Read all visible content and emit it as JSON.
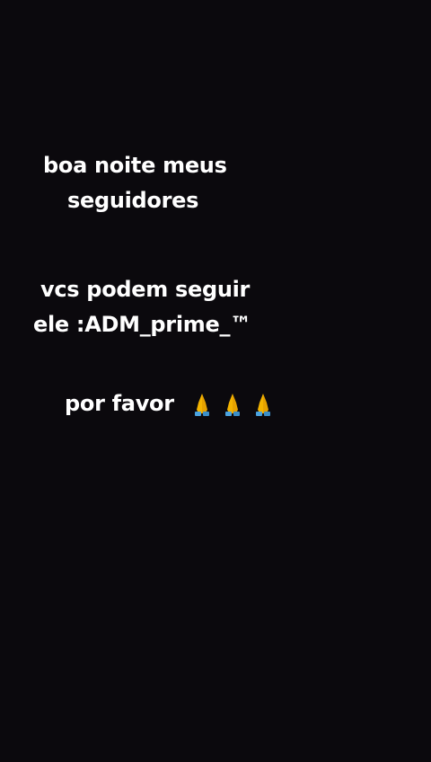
{
  "message": {
    "line1": "boa noite meus",
    "line2": "seguidores",
    "line3": "vcs podem seguir",
    "line4": "ele :ADM_prime_™",
    "line5": "por favor",
    "emojis": [
      "folded-hands",
      "folded-hands",
      "folded-hands"
    ]
  },
  "colors": {
    "background": "#0b090d",
    "text": "#ffffff",
    "emoji_skin": "#f4b400",
    "emoji_sleeve": "#4aa3df"
  }
}
